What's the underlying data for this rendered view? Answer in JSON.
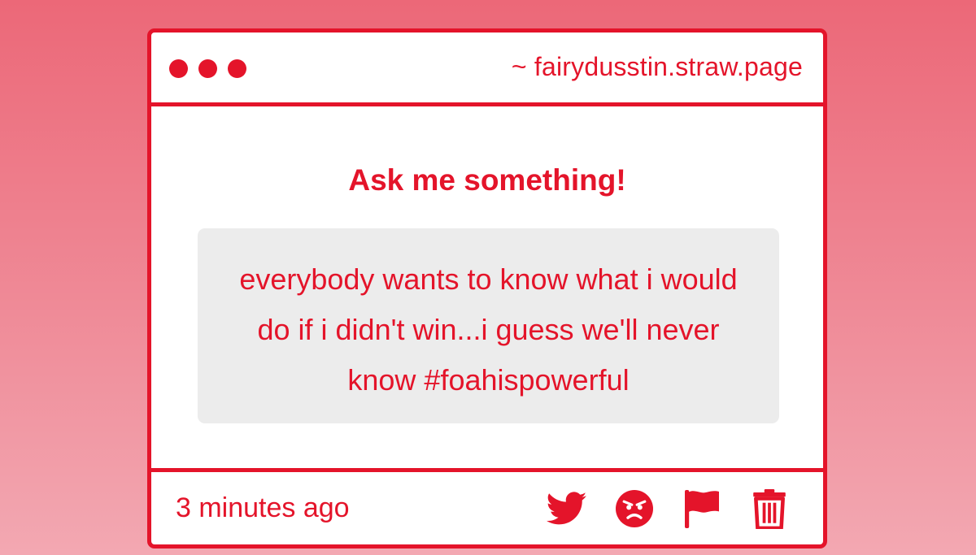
{
  "window": {
    "dots": [
      "dot-1",
      "dot-2",
      "dot-3"
    ],
    "url": "~ fairydusstin.straw.page"
  },
  "main": {
    "heading": "Ask me something!",
    "question": "everybody wants to know what i would do if i didn't win...i guess we'll never know #foahispowerful"
  },
  "footer": {
    "timestamp": "3 minutes ago",
    "actions": [
      {
        "icon": "twitter-icon",
        "name": "share-twitter-button"
      },
      {
        "icon": "angry-face-icon",
        "name": "react-angry-button"
      },
      {
        "icon": "flag-icon",
        "name": "report-flag-button"
      },
      {
        "icon": "trash-icon",
        "name": "delete-button"
      }
    ]
  },
  "colors": {
    "accent": "#e4142a",
    "card_background": "#ffffff",
    "question_background": "#ececec",
    "page_background_top": "#ec6878",
    "page_background_bottom": "#f3a8b2"
  }
}
